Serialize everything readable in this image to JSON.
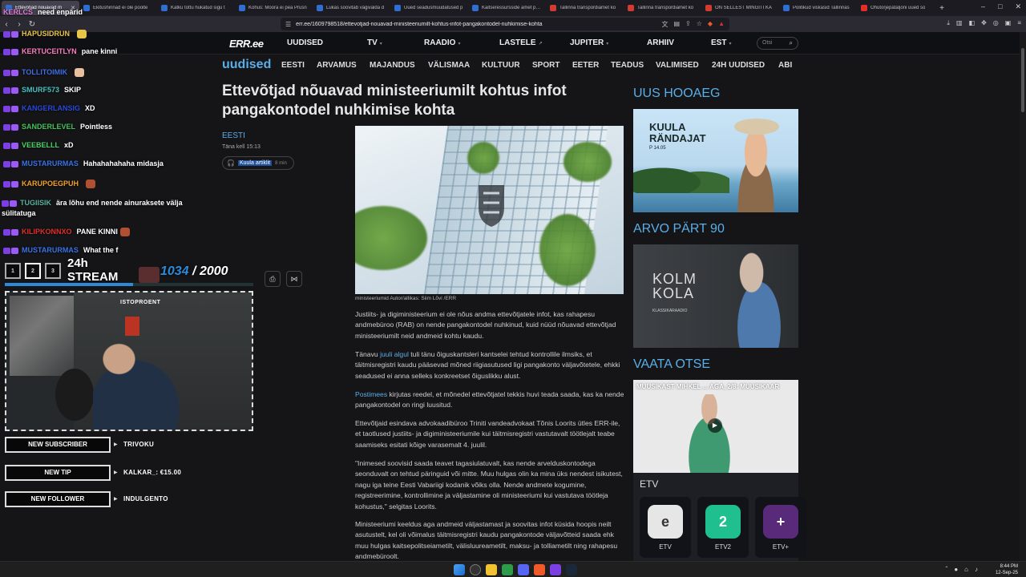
{
  "browser": {
    "tabs": [
      {
        "title": "Ettevõtjad nõuavad m",
        "active": true
      },
      {
        "title": "Ekitushinnad ei ole poolte"
      },
      {
        "title": "Katku tõttu hukatud sigu t"
      },
      {
        "title": "Kohus: Moora ei pea Prusn"
      },
      {
        "title": "Lukas soovitab vägivalda d"
      },
      {
        "title": "Uued seadusmuudatused p"
      },
      {
        "title": "Kaitseressursside amet pais"
      },
      {
        "title": "Tallinna transpordiamet ko"
      },
      {
        "title": "Tallinna transpordiamet ko"
      },
      {
        "title": "ON SELLEST MINGITI KA"
      },
      {
        "title": "Politikud viskasid Tallinnas"
      },
      {
        "title": "Õhutõrjepataljoni uued sõ"
      }
    ],
    "url": "err.ee/1609798518/ettevotjad-nouavad-ministeeriumilt-kohtus-infot-pangakontodel-nuhkimise-kohta"
  },
  "site": {
    "logo": "ERR.ee",
    "topnav": [
      "UUDISED",
      "TV",
      "RAADIO",
      "LASTELE",
      "JUPITER",
      "ARHIIV",
      "EST"
    ],
    "search_placeholder": "Otsi",
    "brand": "uudised",
    "subnav": [
      "EESTI",
      "ARVAMUS",
      "MAJANDUS",
      "VÄLISMAA",
      "KULTUUR",
      "SPORT",
      "EETER",
      "TEADUS",
      "VALIMISED",
      "24H UUDISED",
      "ABI"
    ]
  },
  "article": {
    "headline": "Ettevõtjad nõuavad ministeeriumilt kohtus infot pangakontodel nuhkimise kohta",
    "section": "EESTI",
    "time": "Täna kell 15:13",
    "listen_label": "Kuula artiklit",
    "listen_duration": "8 min",
    "caption": "ministeeriumid Autor/allikas: Siim Lõvi /ERR",
    "p1": "Justiits- ja digiministeerium ei ole nõus andma ettevõtjatele infot, kas rahapesu andmebüroo (RAB) on nende pangakontodel nuhkinud, kuid nüüd nõuavad ettevõtjad ministeeriumilt neid andmeid kohtu kaudu.",
    "p2_pre": "Tänavu ",
    "p2_link": "juuli algul",
    "p2_post": " tuli tänu õiguskantsleri kantselei tehtud kontrollile ilmsiks, et täitmisregistri kaudu pääsevad mõned riigiasutused ligi pangakonto väljavõtetele, ehkki seadused ei anna selleks konkreetset õiguslikku alust.",
    "p3_link": "Postimees",
    "p3_post": " kirjutas reedel, et mõnedel ettevõtjatel tekkis huvi teada saada, kas ka nende pangakontodel on ringi luusitud.",
    "p4": "Ettevõtjaid esindava advokaadibüroo Triniti vandeadvokaat Tõnis Loorits ütles ERR-ile, et taotlused justiits- ja digiministeeriumile kui täitmisregistri vastutavalt töötlejalt teabe saamiseks esitati kõige varasemalt 4. juulil.",
    "p5": "\"Inimesed soovisid saada teavet tagasiulatuvalt, kas nende arvelduskontodega seonduvalt on tehtud päringuid või mitte. Muu hulgas olin ka mina üks nendest isikutest, nagu iga teine Eesti Vabariigi kodanik võiks olla. Nende andmete kogumine, registreerimine, kontrollimine ja väljastamine oli ministeeriumi kui vastutava töötleja kohustus,\" selgitas Loorits.",
    "p6": "Ministeeriumi keeldus aga andmeid väljastamast ja soovitas infot küsida hoopis neilt asutustelt, kel oli võimalus täitmisregistri kaudu pangakontode väljavõtteid saada ehk muu hulgas kaitsepolitseiametilt, välisluureametilt, maksu- ja tolliametilt ning rahapesu andmebüroolt."
  },
  "sidebar": {
    "s1_title": "UUS HOOAEG",
    "card1_title": "KUULA\nRÄNDAJAT",
    "card1_sub": "P 14.05",
    "s2_title": "ARVO PÄRT 90",
    "card2_title": "KOLM\nKOLA",
    "card2_sub": "KLASSIKARAADIO",
    "s3_title": "VAATA OTSE",
    "card3_title": "MUUSIKAST MIHKEL ... AGA, 2/8: MUUSIKAAR",
    "etv_label": "ETV",
    "channels": [
      {
        "name": "ETV",
        "logo": "e",
        "bg": "#e6e6e6",
        "fg": "#333"
      },
      {
        "name": "ETV2",
        "logo": "2",
        "bg": "#1fbf8f",
        "fg": "#fff"
      },
      {
        "name": "ETV+",
        "logo": "+",
        "bg": "#5a2a7a",
        "fg": "#fff"
      }
    ]
  },
  "overlay": {
    "chat": [
      {
        "user": "KERLCS",
        "msg": "need enpärid",
        "color": "#e07bd4"
      },
      {
        "user": "HAPUSIDRUN",
        "msg": "",
        "color": "#e8c547"
      },
      {
        "user": "KERTUCEITLYN",
        "msg": "pane kinni",
        "color": "#ff7fbf"
      },
      {
        "user": "TOLLITOIMIK",
        "msg": "",
        "color": "#3f6fe6"
      },
      {
        "user": "SMURF573",
        "msg": "SKIP",
        "color": "#47c2c2"
      },
      {
        "user": "KANGERLANSIG",
        "msg": "XD",
        "color": "#2a4ad8"
      },
      {
        "user": "SANDERLEVEL",
        "msg": "Pointless",
        "color": "#44c25a"
      },
      {
        "user": "VEEBELLL",
        "msg": "xD",
        "color": "#4ad26a"
      },
      {
        "user": "MUSTARURMAS",
        "msg": "Hahahahahaha midasja",
        "color": "#3a72e6"
      },
      {
        "user": "KARUPOEGPUH",
        "msg": "",
        "color": "#f0a030"
      },
      {
        "user": "TUGIISIK",
        "msg": "ära lõhu end nende ainuraksete välja sülitatuga",
        "color": "#5ab0a0"
      },
      {
        "user": "KILIPKONNXO",
        "msg": "PANE KINNI",
        "color": "#e0302a"
      },
      {
        "user": "MUSTARURMAS",
        "msg": "What the f",
        "color": "#3a72e6"
      }
    ],
    "stream_boxes": [
      "1",
      "2",
      "3"
    ],
    "stream_label": "24h\nSTREAM",
    "goal_current": "1034",
    "goal_sep": " / ",
    "goal_total": "2000",
    "goal_fraction": 0.517,
    "cam_sign": "ISTOPROENT",
    "alerts": [
      {
        "label": "NEW SUBSCRIBER",
        "value": "TRIVOKU"
      },
      {
        "label": "NEW TIP",
        "value": "KALKAR_: €15.00"
      },
      {
        "label": "NEW FOLLOWER",
        "value": "INDULGENTO"
      }
    ]
  },
  "taskbar": {
    "time": "8:44 PM",
    "date": "12-Sep-25"
  }
}
